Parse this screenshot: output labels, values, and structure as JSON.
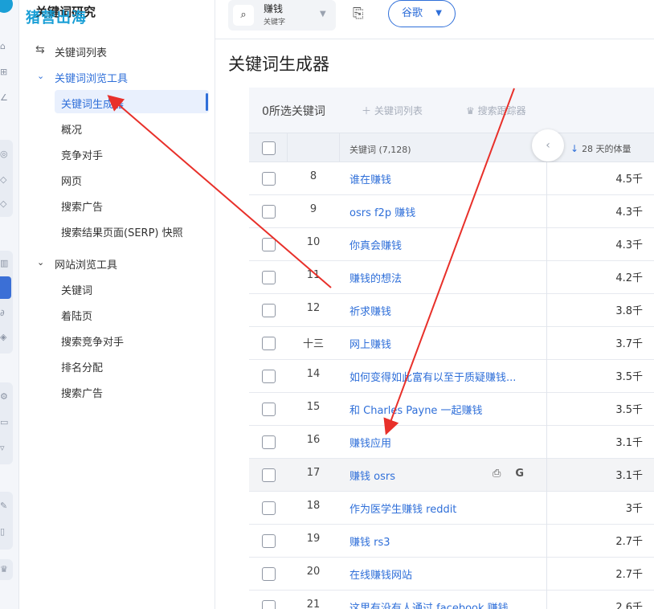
{
  "brand": {
    "title": "关键词研究",
    "watermark": "猪营出海"
  },
  "sidebar": {
    "items": [
      {
        "label": "关键词列表",
        "icon": "list-icon"
      },
      {
        "label": "关键词浏览工具",
        "icon": "chevron-down-icon"
      },
      {
        "label": "关键词生成器"
      },
      {
        "label": "概况"
      },
      {
        "label": "竞争对手"
      },
      {
        "label": "网页"
      },
      {
        "label": "搜索广告"
      },
      {
        "label": "搜索结果页面(SERP) 快照"
      },
      {
        "label": "网站浏览工具",
        "icon": "chevron-down-icon"
      },
      {
        "label": "关键词"
      },
      {
        "label": "着陆页"
      },
      {
        "label": "搜索竞争对手"
      },
      {
        "label": "排名分配"
      },
      {
        "label": "搜索广告"
      }
    ]
  },
  "search": {
    "value": "赚钱",
    "sublabel": "关键字",
    "icon": "search-icon"
  },
  "engine": {
    "label": "谷歌"
  },
  "page_title": "关键词生成器",
  "toolbar": {
    "selected_count": "0所选关键词",
    "add_to_list": "关键词列表",
    "rank_tracker": "搜索跟踪器"
  },
  "table": {
    "columns": {
      "keyword": "关键词 (7,128)",
      "volume": "28 天的体量"
    },
    "rows": [
      {
        "rank": "8",
        "keyword": "谁在赚钱",
        "volume": "4.5千"
      },
      {
        "rank": "9",
        "keyword": "osrs f2p 赚钱",
        "volume": "4.3千"
      },
      {
        "rank": "10",
        "keyword": "你真会赚钱",
        "volume": "4.3千"
      },
      {
        "rank": "11",
        "keyword": "赚钱的想法",
        "volume": "4.2千"
      },
      {
        "rank": "12",
        "keyword": "祈求赚钱",
        "volume": "3.8千"
      },
      {
        "rank": "十三",
        "keyword": "网上赚钱",
        "volume": "3.7千"
      },
      {
        "rank": "14",
        "keyword": "如何变得如此富有以至于质疑赚钱...",
        "volume": "3.5千"
      },
      {
        "rank": "15",
        "keyword": "和 Charles Payne 一起赚钱",
        "volume": "3.5千"
      },
      {
        "rank": "16",
        "keyword": "赚钱应用",
        "volume": "3.1千"
      },
      {
        "rank": "17",
        "keyword": "赚钱 osrs",
        "volume": "3.1千"
      },
      {
        "rank": "18",
        "keyword": "作为医学生赚钱 reddit",
        "volume": "3千"
      },
      {
        "rank": "19",
        "keyword": "赚钱 rs3",
        "volume": "2.7千"
      },
      {
        "rank": "20",
        "keyword": "在线赚钱网站",
        "volume": "2.7千"
      },
      {
        "rank": "21",
        "keyword": "这里有没有人通过 facebook 赚钱...",
        "volume": "2.6千"
      }
    ]
  },
  "colors": {
    "accent": "#2f6fd9",
    "annotation": "#e8302a"
  }
}
